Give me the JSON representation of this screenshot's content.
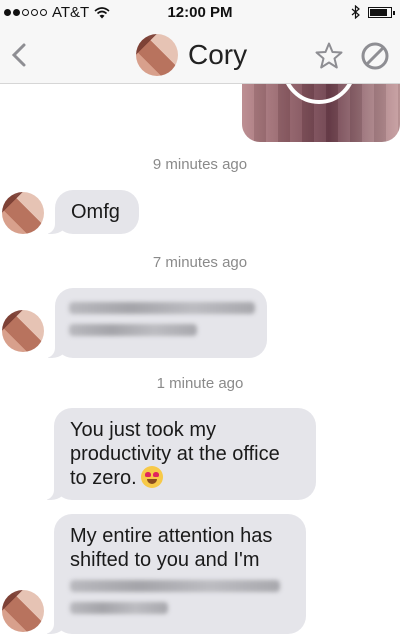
{
  "status_bar": {
    "carrier": "AT&T",
    "time": "12:00 PM",
    "signal_bars_filled": 2,
    "signal_bars_total": 5,
    "battery_level": 0.85,
    "icons": [
      "wifi-icon",
      "bluetooth-icon",
      "battery-icon"
    ]
  },
  "nav_bar": {
    "contact_name": "Cory",
    "icons": [
      "back-chevron-icon",
      "star-icon",
      "block-icon"
    ]
  },
  "messages": [
    {
      "type": "timestamp",
      "text": "9 minutes ago"
    },
    {
      "type": "incoming",
      "text": "Omfg"
    },
    {
      "type": "timestamp",
      "text": "7 minutes ago"
    },
    {
      "type": "incoming",
      "text": "",
      "blurred_lines": 2
    },
    {
      "type": "timestamp",
      "text": "1 minute ago"
    },
    {
      "type": "incoming",
      "text": "You just took my\nproductivity at the office\nto zero.",
      "emoji": "heart-eyes-emoji"
    },
    {
      "type": "incoming",
      "text": "My entire attention has\nshifted to you and I'm",
      "blurred_lines": 2
    }
  ],
  "colors": {
    "incoming_bubble": "#e5e5ea",
    "bar_background": "#f7f7f7",
    "timestamp_text": "#8a8a8a"
  }
}
